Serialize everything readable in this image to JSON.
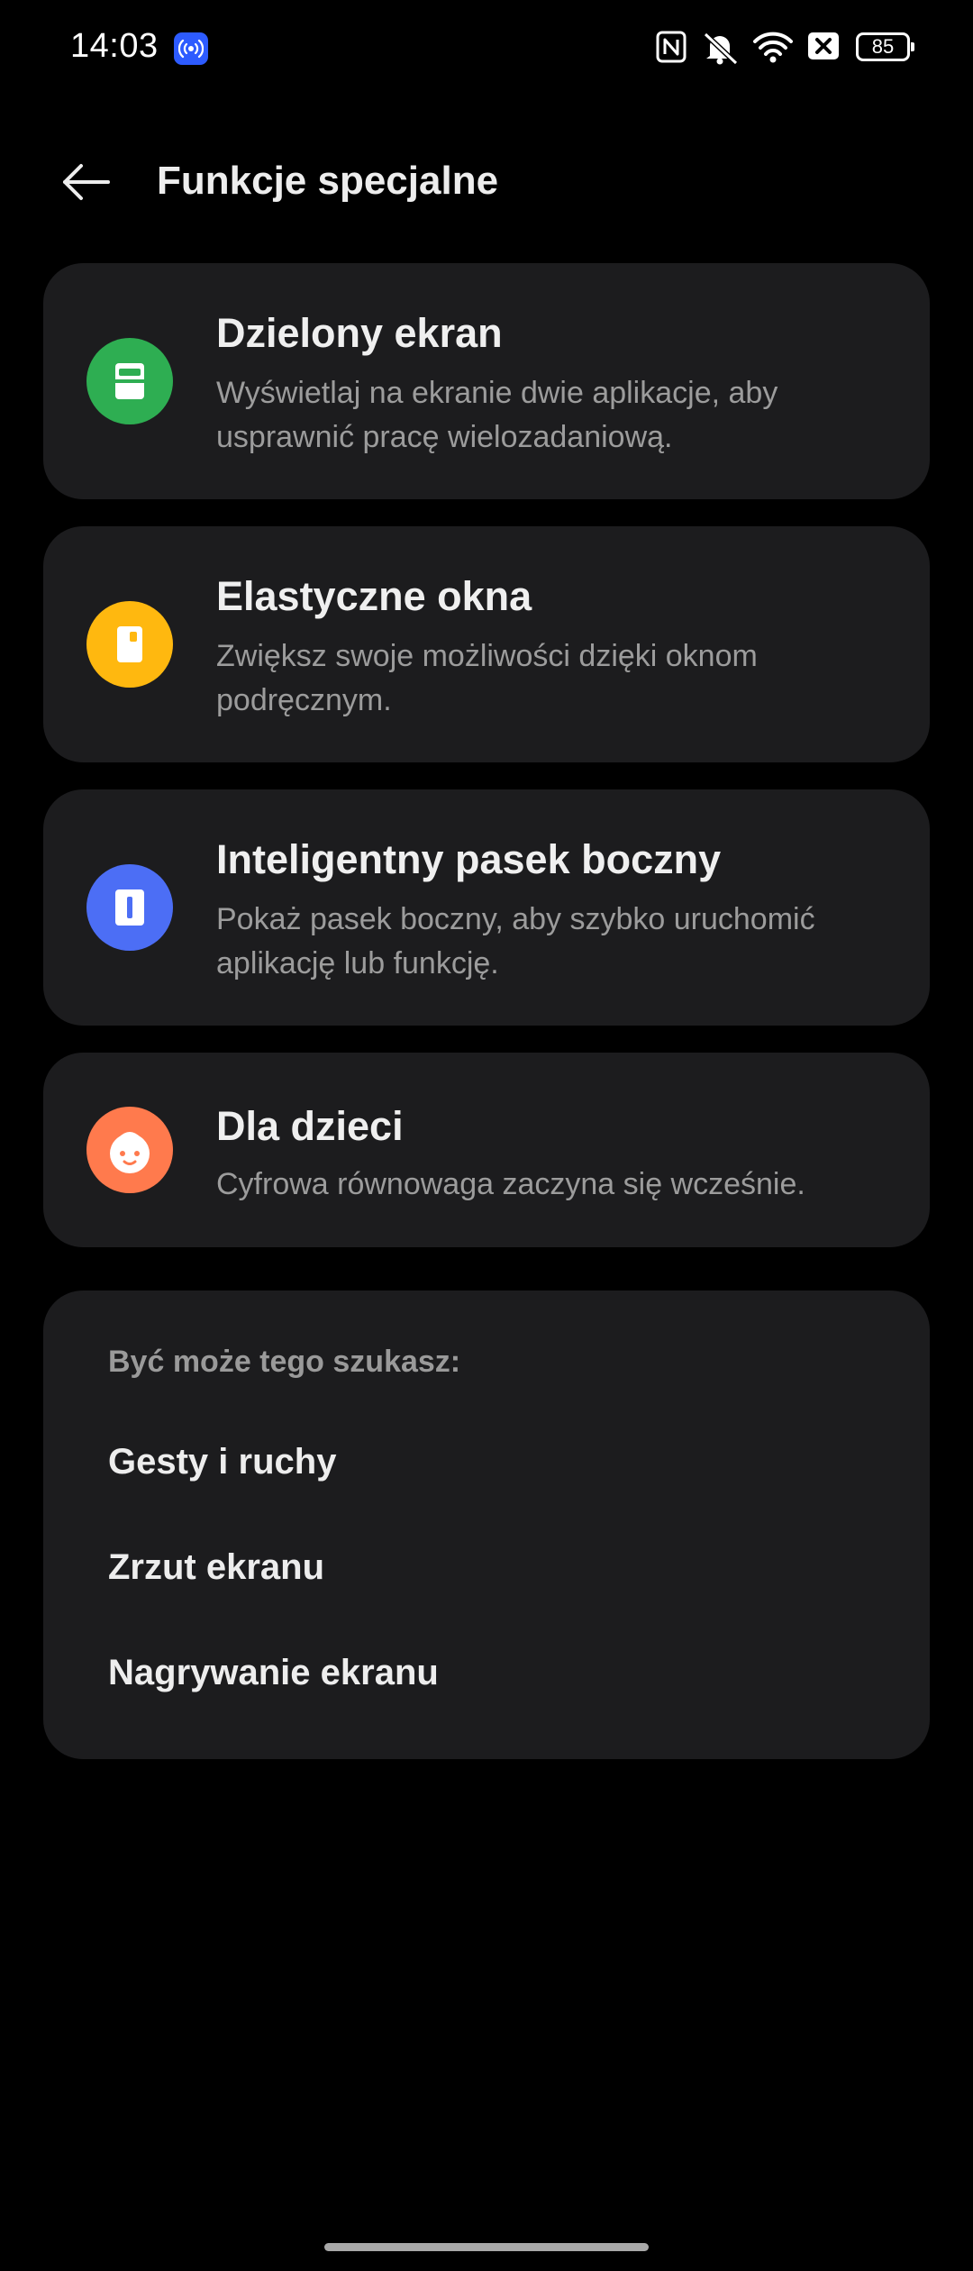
{
  "status_bar": {
    "time": "14:03",
    "battery_level": "85",
    "icons": [
      "hotspot-icon",
      "nfc-icon",
      "mute-icon",
      "wifi-icon",
      "sim-x-icon",
      "battery-icon"
    ]
  },
  "header": {
    "back_icon": "arrow-left-icon",
    "title": "Funkcje specjalne"
  },
  "features": [
    {
      "title": "Dzielony ekran",
      "description": "Wyświetlaj na ekranie dwie aplikacje, aby usprawnić pracę wielozadaniową.",
      "icon": "split-screen-icon",
      "color": "#2EAE52"
    },
    {
      "title": "Elastyczne okna",
      "description": "Zwiększ swoje możliwości dzięki oknom podręcznym.",
      "icon": "flexible-window-icon",
      "color": "#FFB80F"
    },
    {
      "title": "Inteligentny pasek boczny",
      "description": "Pokaż pasek boczny, aby szybko uruchomić aplikację lub funkcję.",
      "icon": "sidebar-icon",
      "color": "#4C6EF5"
    },
    {
      "title": "Dla dzieci",
      "description": "Cyfrowa równowaga zaczyna się wcześnie.",
      "icon": "kid-face-icon",
      "color": "#FF7A4D"
    }
  ],
  "suggestions": {
    "heading": "Być może tego szukasz:",
    "items": [
      "Gesty i ruchy",
      "Zrzut ekranu",
      "Nagrywanie ekranu"
    ]
  }
}
